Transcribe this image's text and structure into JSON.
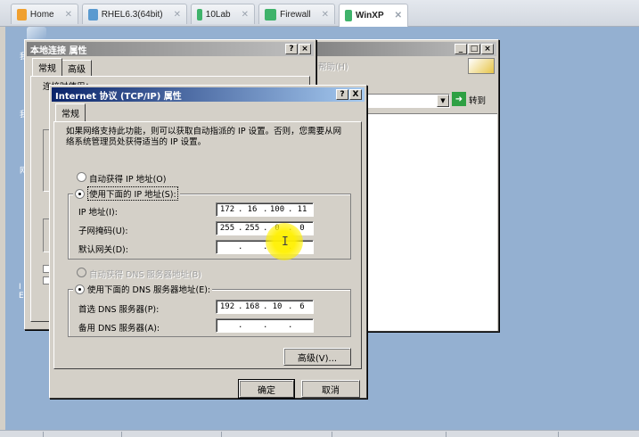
{
  "host_tabs": [
    {
      "label": "Home",
      "icon": "home-icon",
      "color": "#f0a030"
    },
    {
      "label": "RHEL6.3(64bit)",
      "icon": "vm-icon",
      "color": "#5a9ad0"
    },
    {
      "label": "10Lab",
      "icon": "vm-icon",
      "color": "#3fb36b"
    },
    {
      "label": "Firewall",
      "icon": "vm-icon",
      "color": "#3fb36b"
    },
    {
      "label": "WinXP",
      "icon": "vm-icon",
      "color": "#3fb36b",
      "active": true
    }
  ],
  "conn_props": {
    "title": "本地连接 属性",
    "tabs": [
      "常规",
      "高级"
    ],
    "partial_text": "连接时使用："
  },
  "back_window": {
    "menu_help": "帮助(H)",
    "goto_label": "转到"
  },
  "desktop_fragments": [
    "我",
    "我",
    "网",
    "I",
    "E"
  ],
  "tcpip": {
    "title": "Internet 协议 (TCP/IP) 属性",
    "tab": "常规",
    "description": "如果网络支持此功能，则可以获取自动指派的 IP 设置。否则，您需要从网络系统管理员处获得适当的 IP 设置。",
    "auto_ip": "自动获得 IP 地址(O)",
    "manual_ip": "使用下面的 IP 地址(S):",
    "ip_label": "IP 地址(I):",
    "ip_value": [
      "172",
      "16",
      "100",
      "11"
    ],
    "mask_label": "子网掩码(U):",
    "mask_value": [
      "255",
      "255",
      "0",
      "0"
    ],
    "gateway_label": "默认网关(D):",
    "gateway_value": [
      "",
      "",
      "",
      ""
    ],
    "auto_dns": "自动获得 DNS 服务器地址(B)",
    "manual_dns": "使用下面的 DNS 服务器地址(E):",
    "pref_dns_label": "首选 DNS 服务器(P):",
    "pref_dns_value": [
      "192",
      "168",
      "10",
      "6"
    ],
    "alt_dns_label": "备用 DNS 服务器(A):",
    "alt_dns_value": [
      "",
      "",
      "",
      ""
    ],
    "advanced_button": "高级(V)...",
    "ok_button": "确定",
    "cancel_button": "取消",
    "title_help": "?",
    "title_close": "X"
  }
}
